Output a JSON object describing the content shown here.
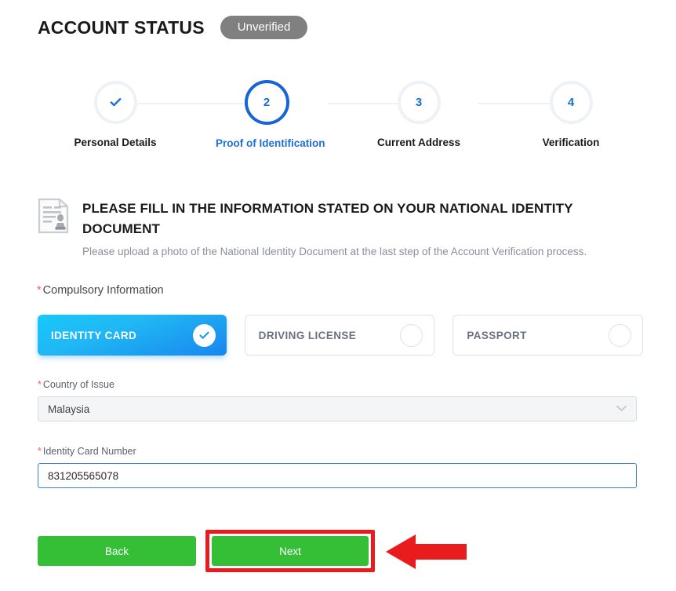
{
  "header": {
    "title": "ACCOUNT STATUS",
    "status_badge": "Unverified",
    "status_badge_color": "#808080"
  },
  "stepper": {
    "steps": [
      {
        "number": "1",
        "label": "Personal Details",
        "state": "completed",
        "icon": "check-icon"
      },
      {
        "number": "2",
        "label": "Proof of Identification",
        "state": "current"
      },
      {
        "number": "3",
        "label": "Current Address",
        "state": "upcoming"
      },
      {
        "number": "4",
        "label": "Verification",
        "state": "upcoming"
      }
    ],
    "active_color": "#1565d8",
    "inactive_color": "#eef2f7"
  },
  "section": {
    "icon": "identity-document-icon",
    "heading": "PLEASE FILL IN THE INFORMATION STATED ON YOUR NATIONAL IDENTITY DOCUMENT",
    "subtext": "Please upload a photo of the National Identity Document at the last step of the Account Verification process."
  },
  "form": {
    "compulsory_label": "Compulsory Information",
    "required_marker": "*",
    "required_color": "#ff5c5c",
    "document_options": [
      {
        "label": "IDENTITY CARD",
        "selected": true
      },
      {
        "label": "DRIVING LICENSE",
        "selected": false
      },
      {
        "label": "PASSPORT",
        "selected": false
      }
    ],
    "country_of_issue": {
      "label": "Country of Issue",
      "value": "Malaysia",
      "chevron": "chevron-down-icon"
    },
    "identity_card_number": {
      "label": "Identity Card Number",
      "value": "831205565078",
      "focused": true
    }
  },
  "actions": {
    "back_label": "Back",
    "next_label": "Next",
    "button_color": "#34bf37"
  },
  "annotation": {
    "highlight_color": "#e81c1c",
    "highlight_target": "next-button",
    "arrow": "left-pointing-arrow"
  }
}
